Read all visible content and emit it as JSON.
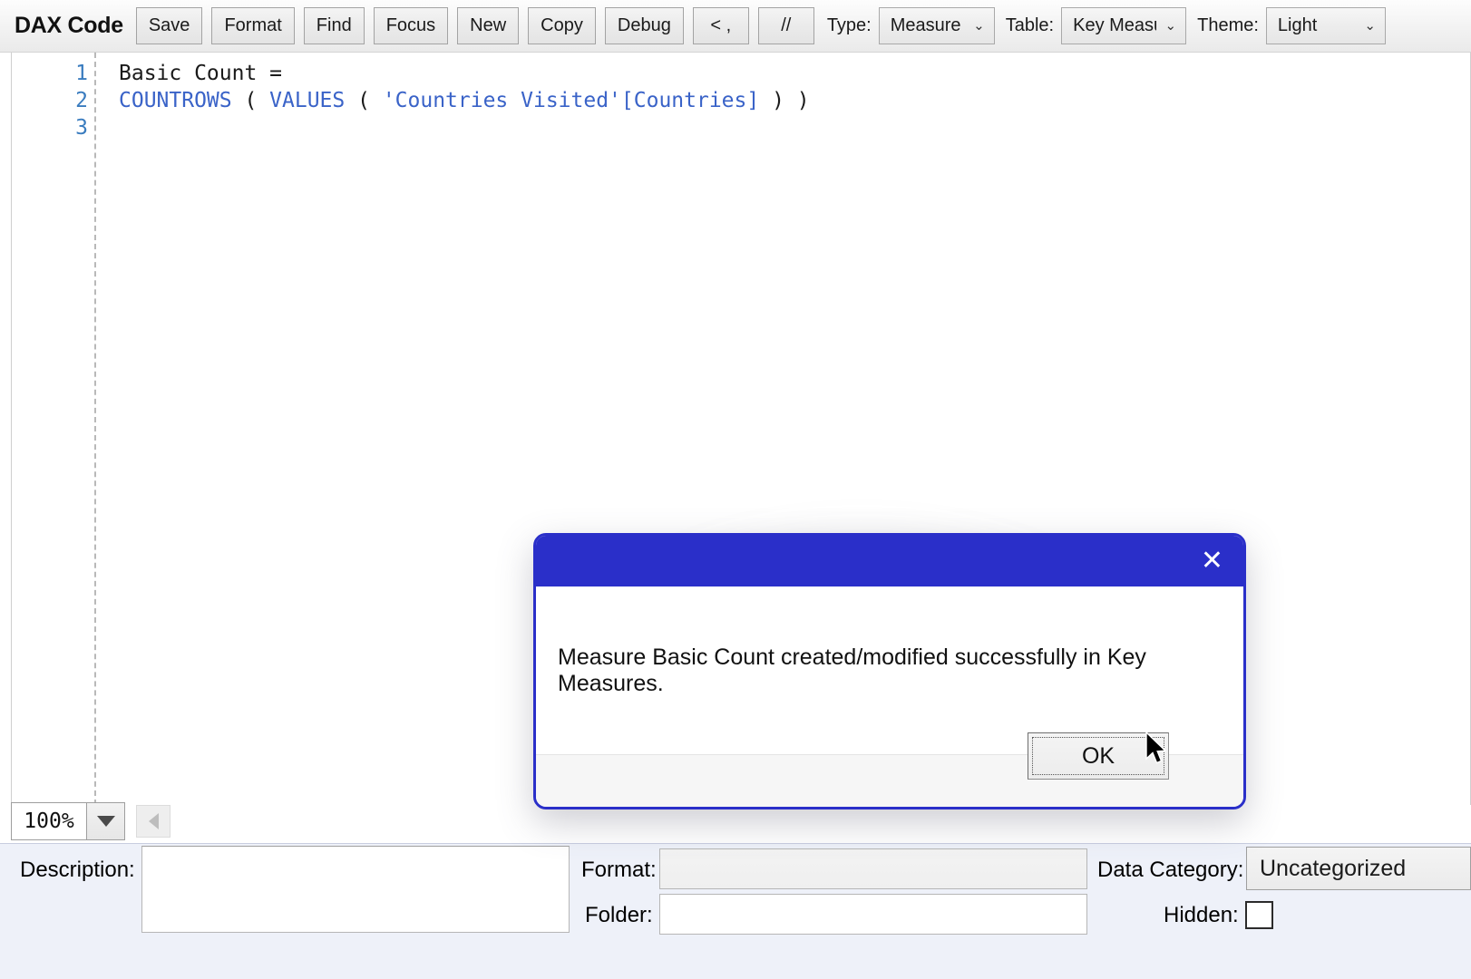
{
  "toolbar": {
    "title": "DAX Code",
    "buttons": [
      {
        "name": "save",
        "label": "Save"
      },
      {
        "name": "format",
        "label": "Format"
      },
      {
        "name": "find",
        "label": "Find"
      },
      {
        "name": "focus",
        "label": "Focus"
      },
      {
        "name": "new",
        "label": "New"
      },
      {
        "name": "copy",
        "label": "Copy"
      },
      {
        "name": "debug",
        "label": "Debug"
      },
      {
        "name": "less-comma",
        "label": "< ,"
      },
      {
        "name": "comment",
        "label": "//"
      }
    ],
    "type": {
      "label": "Type:",
      "value": "Measure",
      "chevron": "chevron-down-icon"
    },
    "table": {
      "label": "Table:",
      "value": "Key Measu",
      "chevron": "chevron-down-icon"
    },
    "theme": {
      "label": "Theme:",
      "value": "Light",
      "chevron": "chevron-down-icon"
    }
  },
  "editor": {
    "line_numbers": [
      "1",
      "2",
      "3"
    ],
    "code": {
      "line1_name": "Basic Count ",
      "line1_eq": "=",
      "line2_fn1": "COUNTROWS",
      "line2_p1": " ( ",
      "line2_fn2": "VALUES",
      "line2_p2": " ( ",
      "line2_ref": "'Countries Visited'[Countries]",
      "line2_p3": " ) )"
    }
  },
  "zoombar": {
    "zoom_value": "100%",
    "dropdown_icon": "triangle-down-icon",
    "nav_left_icon": "triangle-left-icon"
  },
  "properties": {
    "description_label": "Description:",
    "description_value": "",
    "format_label": "Format:",
    "format_value": "",
    "folder_label": "Folder:",
    "folder_value": "",
    "data_category_label": "Data Category:",
    "data_category_value": "Uncategorized",
    "hidden_label": "Hidden:",
    "hidden_checked": false
  },
  "dialog": {
    "close_icon": "close-icon",
    "close_glyph": "✕",
    "message": "Measure Basic Count created/modified successfully in Key Measures.",
    "ok_label": "OK",
    "title_color": "#2a2fc9",
    "border_color": "#2a2fc9"
  },
  "cursor": {
    "icon": "mouse-pointer-icon"
  }
}
